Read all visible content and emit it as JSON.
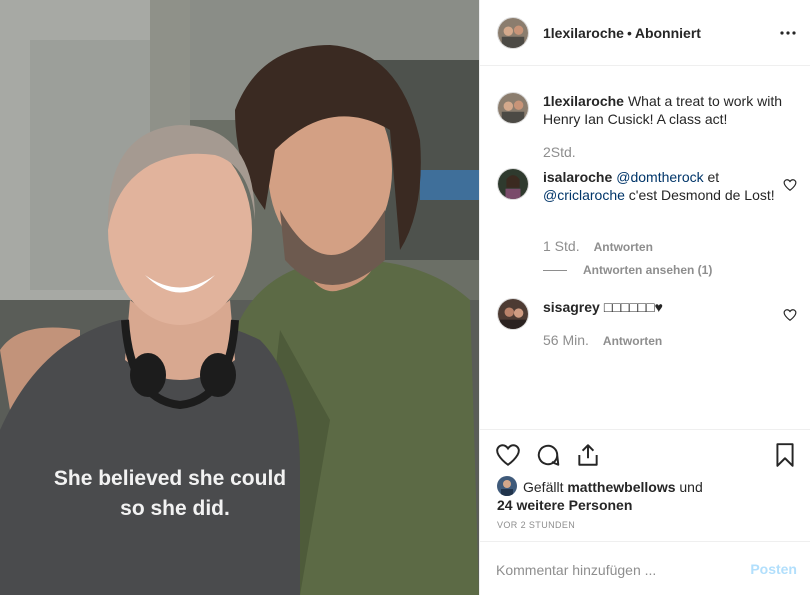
{
  "header": {
    "username": "1lexilaroche",
    "separator": "•",
    "follow_state": "Abonniert",
    "more_icon": "more-horizontal-icon"
  },
  "photo": {
    "shirt_text_line1": "She believed she could",
    "shirt_text_line2": "so she did."
  },
  "caption": {
    "username": "1lexilaroche",
    "text": "What a treat to work with Henry Ian Cusick! A class act!",
    "time": "2Std."
  },
  "comments": [
    {
      "username": "isalaroche",
      "mention1": "@domtherock",
      "text_mid": " et ",
      "mention2": "@criclaroche",
      "text_end": " c'est Desmond de Lost!",
      "time": "1 Std.",
      "reply_label": "Antworten",
      "view_replies": "Antworten ansehen (1)"
    },
    {
      "username": "sisagrey",
      "text": "□□□□□□♥",
      "time": "56 Min.",
      "reply_label": "Antworten"
    }
  ],
  "actions": {
    "icons": [
      "heart-icon",
      "comment-icon",
      "share-icon",
      "bookmark-icon"
    ]
  },
  "likes": {
    "prefix": "Gefällt",
    "user": "matthewbellows",
    "mid": "und",
    "others": "24 weitere Personen"
  },
  "timestamp": "VOR 2 STUNDEN",
  "add_comment": {
    "placeholder": "Kommentar hinzufügen ...",
    "post_label": "Posten"
  },
  "colors": {
    "mention": "#003569",
    "muted": "#8e8e8e",
    "post_disabled": "#b2dffc",
    "border": "#efefef"
  }
}
